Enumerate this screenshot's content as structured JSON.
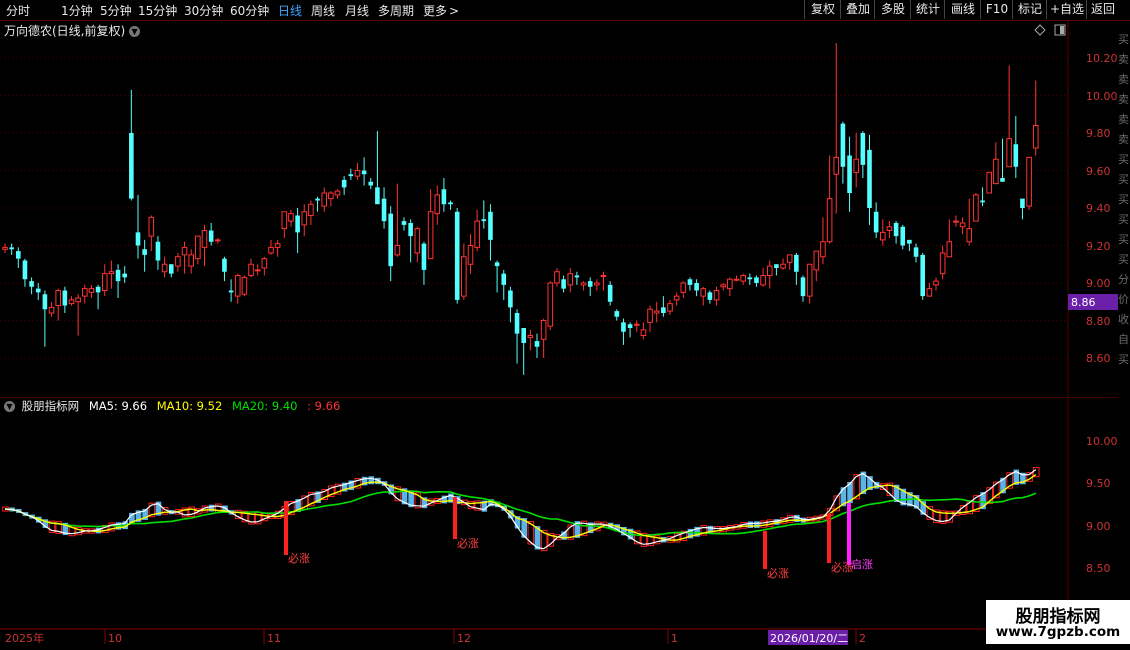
{
  "toolbar": {
    "periods": [
      "分时",
      "1分钟",
      "5分钟",
      "15分钟",
      "30分钟",
      "60分钟",
      "日线",
      "周线",
      "月线",
      "多周期"
    ],
    "active_period": "日线",
    "more": "更多",
    "tools": [
      "复权",
      "叠加",
      "多股",
      "统计",
      "画线",
      "F10",
      "标记",
      "+自选",
      "返回"
    ]
  },
  "main": {
    "title": "万向德农(日线,前复权)",
    "price_ticks": [
      "10.20",
      "10.00",
      "9.80",
      "9.60",
      "9.40",
      "9.20",
      "9.00",
      "8.80",
      "8.60"
    ],
    "current_price": "8.86",
    "current_price_color": "#6a1fa8"
  },
  "indicator": {
    "name": "股朋指标网",
    "ma5": "MA5: 9.66",
    "ma10": "MA10: 9.52",
    "ma20": "MA20: 9.40",
    "last": ": 9.66",
    "ticks": [
      "10.00",
      "9.50",
      "9.00",
      "8.50"
    ],
    "signals": [
      "必涨",
      "必涨",
      "必涨",
      "必涨",
      "启涨"
    ]
  },
  "time_axis": {
    "labels": [
      "2025年",
      "10",
      "11",
      "12",
      "1",
      "2"
    ],
    "cursor_date": "2026/01/20/二"
  },
  "right_strip": [
    "买",
    "卖",
    "卖",
    "卖",
    "卖",
    "卖",
    "买",
    "买",
    "买",
    "买",
    "买",
    "买",
    "分",
    "价",
    "收",
    "自",
    "买"
  ],
  "watermark": {
    "line1": "股朋指标网",
    "line2": "www.7gpzb.com"
  },
  "colors": {
    "up": "#ff3333",
    "down": "#54ffff",
    "ma5": "#ffffff",
    "ma10": "#ffff00",
    "ma20": "#00e000",
    "grid": "#5a0000"
  },
  "candles": [
    [
      9.18,
      9.19,
      9.16,
      9.21
    ],
    [
      9.19,
      9.18,
      9.15,
      9.21
    ],
    [
      9.17,
      9.13,
      9.08,
      9.19
    ],
    [
      9.12,
      9.02,
      8.98,
      9.13
    ],
    [
      9.01,
      8.98,
      8.94,
      9.03
    ],
    [
      8.97,
      8.95,
      8.91,
      9.0
    ],
    [
      8.94,
      8.86,
      8.66,
      8.96
    ],
    [
      8.84,
      8.87,
      8.82,
      8.9
    ],
    [
      8.88,
      8.96,
      8.8,
      8.97
    ],
    [
      8.96,
      8.88,
      8.84,
      8.98
    ],
    [
      8.89,
      8.91,
      8.88,
      8.93
    ],
    [
      8.9,
      8.92,
      8.72,
      8.94
    ],
    [
      8.93,
      8.97,
      8.89,
      8.99
    ],
    [
      8.95,
      8.97,
      8.92,
      8.99
    ],
    [
      8.98,
      8.95,
      8.86,
      8.99
    ],
    [
      8.96,
      9.05,
      8.93,
      9.1
    ],
    [
      9.05,
      9.06,
      8.97,
      9.12
    ],
    [
      9.07,
      9.01,
      8.92,
      9.1
    ],
    [
      9.05,
      9.03,
      9.0,
      9.09
    ],
    [
      9.8,
      9.45,
      9.44,
      10.03
    ],
    [
      9.27,
      9.2,
      9.13,
      9.47
    ],
    [
      9.18,
      9.15,
      9.06,
      9.23
    ],
    [
      9.25,
      9.35,
      9.17,
      9.36
    ],
    [
      9.22,
      9.12,
      9.07,
      9.25
    ],
    [
      9.06,
      9.1,
      9.03,
      9.14
    ],
    [
      9.1,
      9.05,
      9.03,
      9.1
    ],
    [
      9.09,
      9.14,
      9.06,
      9.16
    ],
    [
      9.15,
      9.19,
      9.05,
      9.22
    ],
    [
      9.09,
      9.15,
      9.05,
      9.18
    ],
    [
      9.13,
      9.25,
      9.1,
      9.25
    ],
    [
      9.19,
      9.28,
      9.09,
      9.31
    ],
    [
      9.28,
      9.22,
      9.2,
      9.32
    ],
    [
      9.23,
      9.23,
      9.21,
      9.24
    ],
    [
      9.13,
      9.06,
      9.01,
      9.14
    ],
    [
      8.96,
      8.95,
      8.9,
      9.02
    ],
    [
      8.93,
      9.04,
      8.89,
      9.05
    ],
    [
      8.94,
      9.03,
      8.93,
      9.04
    ],
    [
      9.04,
      9.1,
      9.03,
      9.13
    ],
    [
      9.07,
      9.07,
      9.04,
      9.1
    ],
    [
      9.08,
      9.13,
      9.04,
      9.14
    ],
    [
      9.16,
      9.19,
      9.15,
      9.23
    ],
    [
      9.19,
      9.21,
      9.14,
      9.23
    ],
    [
      9.29,
      9.38,
      9.24,
      9.38
    ],
    [
      9.33,
      9.37,
      9.3,
      9.39
    ],
    [
      9.36,
      9.27,
      9.16,
      9.4
    ],
    [
      9.31,
      9.38,
      9.25,
      9.42
    ],
    [
      9.36,
      9.42,
      9.31,
      9.44
    ],
    [
      9.45,
      9.44,
      9.38,
      9.46
    ],
    [
      9.41,
      9.48,
      9.38,
      9.51
    ],
    [
      9.45,
      9.48,
      9.41,
      9.49
    ],
    [
      9.47,
      9.49,
      9.45,
      9.5
    ],
    [
      9.55,
      9.51,
      9.47,
      9.57
    ],
    [
      9.58,
      9.57,
      9.55,
      9.61
    ],
    [
      9.57,
      9.6,
      9.55,
      9.64
    ],
    [
      9.6,
      9.58,
      9.52,
      9.67
    ],
    [
      9.54,
      9.52,
      9.5,
      9.56
    ],
    [
      9.51,
      9.42,
      9.45,
      9.81
    ],
    [
      9.45,
      9.33,
      9.29,
      9.51
    ],
    [
      9.37,
      9.09,
      9.01,
      9.41
    ],
    [
      9.15,
      9.2,
      9.14,
      9.53
    ],
    [
      9.33,
      9.31,
      9.28,
      9.35
    ],
    [
      9.32,
      9.25,
      9.11,
      9.34
    ],
    [
      9.16,
      9.29,
      9.11,
      9.3
    ],
    [
      9.21,
      9.07,
      8.99,
      9.22
    ],
    [
      9.13,
      9.38,
      9.13,
      9.5
    ],
    [
      9.37,
      9.47,
      9.31,
      9.52
    ],
    [
      9.5,
      9.42,
      9.38,
      9.56
    ],
    [
      9.43,
      9.42,
      9.39,
      9.44
    ],
    [
      9.38,
      8.91,
      8.89,
      9.4
    ],
    [
      8.93,
      9.14,
      8.91,
      9.21
    ],
    [
      9.1,
      9.2,
      9.05,
      9.26
    ],
    [
      9.19,
      9.33,
      9.17,
      9.39
    ],
    [
      9.34,
      9.33,
      9.29,
      9.44
    ],
    [
      9.38,
      9.23,
      9.12,
      9.42
    ],
    [
      9.11,
      9.09,
      8.95,
      9.12
    ],
    [
      9.05,
      8.99,
      8.91,
      9.07
    ],
    [
      8.96,
      8.87,
      8.79,
      8.98
    ],
    [
      8.84,
      8.73,
      8.57,
      8.86
    ],
    [
      8.76,
      8.68,
      8.51,
      8.75
    ],
    [
      8.71,
      8.72,
      8.64,
      8.75
    ],
    [
      8.69,
      8.66,
      8.6,
      8.73
    ],
    [
      8.7,
      8.8,
      8.6,
      8.81
    ],
    [
      8.77,
      9.0,
      8.75,
      9.01
    ],
    [
      9.0,
      9.06,
      8.98,
      9.08
    ],
    [
      9.02,
      8.97,
      8.95,
      9.04
    ],
    [
      8.99,
      9.05,
      8.95,
      9.08
    ],
    [
      9.04,
      9.03,
      8.99,
      9.06
    ],
    [
      8.99,
      9.0,
      8.96,
      9.01
    ],
    [
      9.01,
      8.98,
      8.93,
      9.03
    ],
    [
      8.99,
      9.0,
      8.96,
      9.02
    ],
    [
      9.04,
      9.04,
      8.96,
      9.06
    ],
    [
      8.99,
      8.9,
      8.88,
      9.01
    ],
    [
      8.85,
      8.82,
      8.8,
      8.86
    ],
    [
      8.79,
      8.74,
      8.67,
      8.81
    ],
    [
      8.78,
      8.76,
      8.71,
      8.79
    ],
    [
      8.78,
      8.78,
      8.74,
      8.8
    ],
    [
      8.72,
      8.75,
      8.7,
      8.79
    ],
    [
      8.79,
      8.86,
      8.74,
      8.88
    ],
    [
      8.84,
      8.85,
      8.79,
      8.9
    ],
    [
      8.87,
      8.84,
      8.82,
      8.93
    ],
    [
      8.85,
      8.89,
      8.83,
      8.91
    ],
    [
      8.91,
      8.93,
      8.88,
      8.95
    ],
    [
      8.95,
      9.0,
      8.92,
      9.01
    ],
    [
      9.02,
      8.99,
      8.96,
      9.03
    ],
    [
      9.0,
      8.96,
      8.93,
      9.02
    ],
    [
      8.93,
      8.97,
      8.88,
      8.98
    ],
    [
      8.95,
      8.91,
      8.89,
      8.96
    ],
    [
      8.91,
      8.96,
      8.88,
      8.98
    ],
    [
      8.98,
      8.99,
      8.96,
      9.0
    ],
    [
      8.97,
      9.02,
      8.93,
      9.03
    ],
    [
      9.02,
      9.02,
      9.01,
      9.04
    ],
    [
      9.01,
      9.04,
      8.99,
      9.05
    ],
    [
      9.03,
      9.02,
      8.99,
      9.05
    ],
    [
      9.03,
      9.0,
      8.98,
      9.04
    ],
    [
      8.99,
      9.04,
      8.98,
      9.08
    ],
    [
      9.04,
      9.09,
      8.97,
      9.12
    ],
    [
      9.1,
      9.08,
      9.04,
      9.1
    ],
    [
      9.08,
      9.1,
      9.07,
      9.13
    ],
    [
      9.11,
      9.15,
      9.07,
      9.15
    ],
    [
      9.15,
      9.06,
      8.99,
      9.16
    ],
    [
      9.03,
      8.93,
      8.9,
      9.04
    ],
    [
      8.93,
      9.1,
      8.89,
      9.1
    ],
    [
      9.07,
      9.17,
      9.01,
      9.17
    ],
    [
      9.14,
      9.22,
      9.1,
      9.35
    ],
    [
      9.22,
      9.45,
      9.21,
      9.68
    ],
    [
      9.58,
      9.67,
      9.37,
      10.28
    ],
    [
      9.85,
      9.62,
      9.53,
      9.86
    ],
    [
      9.68,
      9.48,
      9.38,
      9.78
    ],
    [
      9.59,
      9.66,
      9.51,
      9.8
    ],
    [
      9.8,
      9.63,
      9.56,
      9.81
    ],
    [
      9.71,
      9.4,
      9.31,
      9.79
    ],
    [
      9.38,
      9.27,
      9.24,
      9.43
    ],
    [
      9.23,
      9.27,
      9.2,
      9.34
    ],
    [
      9.28,
      9.3,
      9.24,
      9.33
    ],
    [
      9.32,
      9.25,
      9.21,
      9.33
    ],
    [
      9.3,
      9.2,
      9.18,
      9.31
    ],
    [
      9.23,
      9.21,
      9.17,
      9.23
    ],
    [
      9.19,
      9.14,
      9.11,
      9.21
    ],
    [
      9.15,
      8.93,
      8.91,
      9.16
    ],
    [
      8.93,
      8.97,
      8.93,
      9.0
    ],
    [
      8.99,
      9.01,
      8.96,
      9.03
    ],
    [
      9.05,
      9.16,
      9.02,
      9.2
    ],
    [
      9.14,
      9.22,
      9.15,
      9.34
    ],
    [
      9.33,
      9.33,
      9.3,
      9.36
    ],
    [
      9.3,
      9.32,
      9.26,
      9.35
    ],
    [
      9.22,
      9.29,
      9.2,
      9.45
    ],
    [
      9.33,
      9.47,
      9.33,
      9.48
    ],
    [
      9.44,
      9.43,
      9.41,
      9.51
    ],
    [
      9.48,
      9.59,
      9.48,
      9.58
    ],
    [
      9.53,
      9.66,
      9.53,
      9.75
    ],
    [
      9.56,
      9.54,
      9.54,
      9.77
    ],
    [
      9.62,
      9.77,
      9.62,
      10.16
    ],
    [
      9.74,
      9.62,
      9.56,
      9.89
    ],
    [
      9.45,
      9.4,
      9.34,
      9.44
    ],
    [
      9.41,
      9.67,
      9.39,
      9.67
    ],
    [
      9.72,
      9.84,
      9.68,
      10.08
    ]
  ]
}
